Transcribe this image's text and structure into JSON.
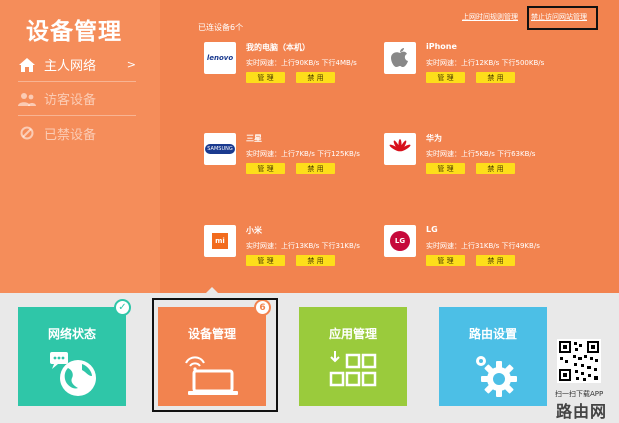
{
  "sidebar": {
    "title": "设备管理",
    "items": [
      {
        "label": "主人网络",
        "icon": "home-icon",
        "arrow": ">"
      },
      {
        "label": "访客设备",
        "icon": "guests-icon"
      },
      {
        "label": "已禁设备",
        "icon": "ban-icon"
      }
    ]
  },
  "main": {
    "connected_label": "已连设备6个",
    "links": {
      "time_control": "上网时间规则管理",
      "block_site": "禁止访问网站管理"
    },
    "speed_prefix": "实时网速：",
    "manage_label": "管 理",
    "ban_label": "禁 用",
    "devices": [
      {
        "name": "我的电脑（本机）",
        "speed": "实时网速：上行90KB/s  下行4MB/s",
        "logo": "lenovo-logo",
        "logo_text": "lenovo"
      },
      {
        "name": "iPhone",
        "speed": "实时网速：上行12KB/s  下行500KB/s",
        "logo": "apple-logo"
      },
      {
        "name": "三星",
        "speed": "实时网速：上行7KB/s  下行125KB/s",
        "logo": "samsung-logo",
        "logo_text": "SAMSUNG"
      },
      {
        "name": "华为",
        "speed": "实时网速：上行5KB/s  下行63KB/s",
        "logo": "huawei-logo"
      },
      {
        "name": "小米",
        "speed": "实时网速：上行13KB/s  下行31KB/s",
        "logo": "xiaomi-logo",
        "logo_text": "mi"
      },
      {
        "name": "LG",
        "speed": "实时网速：上行31KB/s  下行49KB/s",
        "logo": "lg-logo",
        "logo_text": "LG"
      }
    ]
  },
  "tiles": [
    {
      "label": "网络状态",
      "color": "#2fc6a8",
      "badge": "✓"
    },
    {
      "label": "设备管理",
      "color": "#f2834f",
      "badge": "6"
    },
    {
      "label": "应用管理",
      "color": "#9acb3c"
    },
    {
      "label": "路由设置",
      "color": "#4cbfe6"
    }
  ],
  "footer": {
    "qr_text": "扫一扫下载APP",
    "watermark": "路由网"
  },
  "colors": {
    "accent_orange": "#f2834f",
    "button_yellow": "#fdde1a"
  }
}
